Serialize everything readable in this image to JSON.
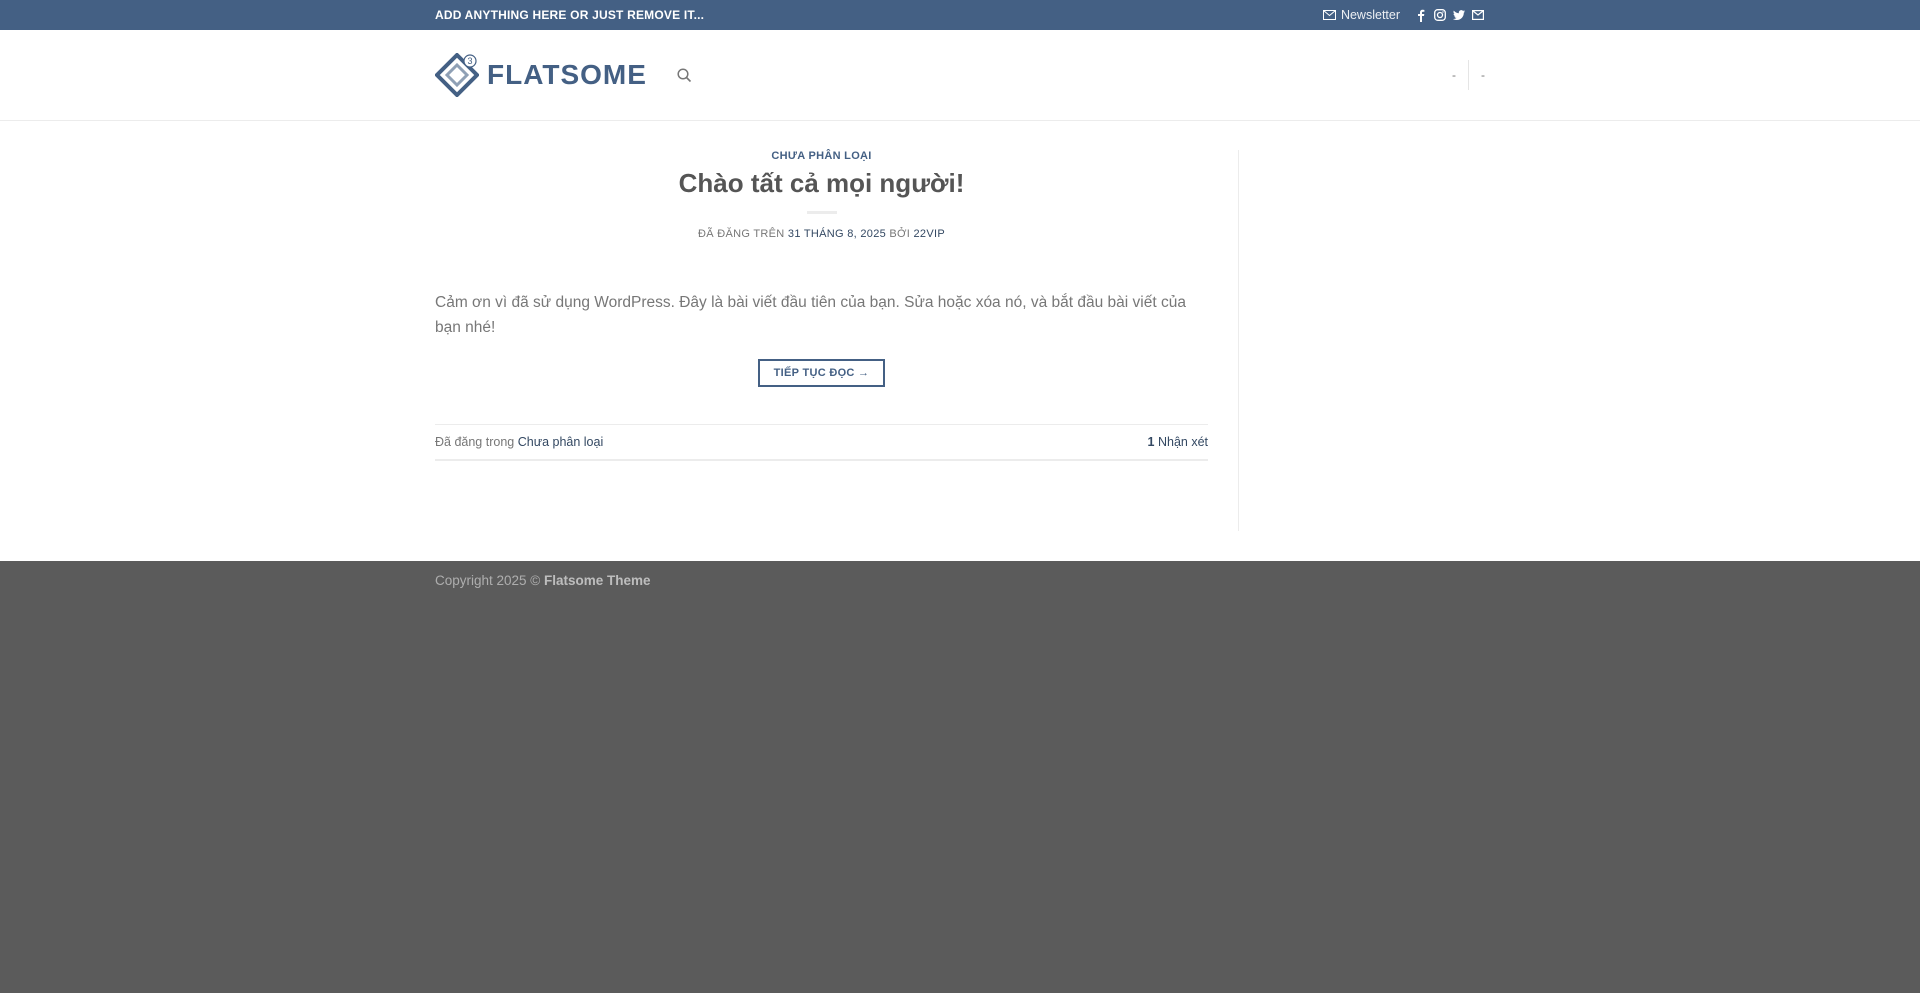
{
  "topbar": {
    "left_text": "ADD ANYTHING HERE OR JUST REMOVE IT...",
    "newsletter_label": "Newsletter",
    "social_icons": [
      "facebook-icon",
      "instagram-icon",
      "twitter-icon",
      "envelope-icon"
    ]
  },
  "header": {
    "logo_text": "FLATSOME",
    "logo_badge": "3",
    "right_links": [
      "-",
      "-"
    ]
  },
  "post": {
    "category": "CHƯA PHÂN LOẠI",
    "title": "Chào tất cả mọi người!",
    "meta_prefix": "ĐÃ ĐĂNG TRÊN",
    "date": "31 THÁNG 8, 2025",
    "by_label": "BỞI",
    "author": "22VIP",
    "excerpt": "Cảm ơn vì đã sử dụng WordPress. Đây là bài viết đầu tiên của bạn. Sửa hoặc xóa nó, và bắt đầu bài viết của bạn nhé!",
    "read_more": "TIẾP TỤC ĐỌC →",
    "posted_in_label": "Đã đăng trong",
    "posted_in_category": "Chưa phân loại",
    "comment_count": "1",
    "comment_label": "Nhận xét"
  },
  "footer": {
    "copyright": "Copyright 2025 ©",
    "theme_name": "Flatsome Theme"
  },
  "colors": {
    "primary": "#446084",
    "link": "#334862",
    "footer_bg": "#5b5b5b"
  }
}
